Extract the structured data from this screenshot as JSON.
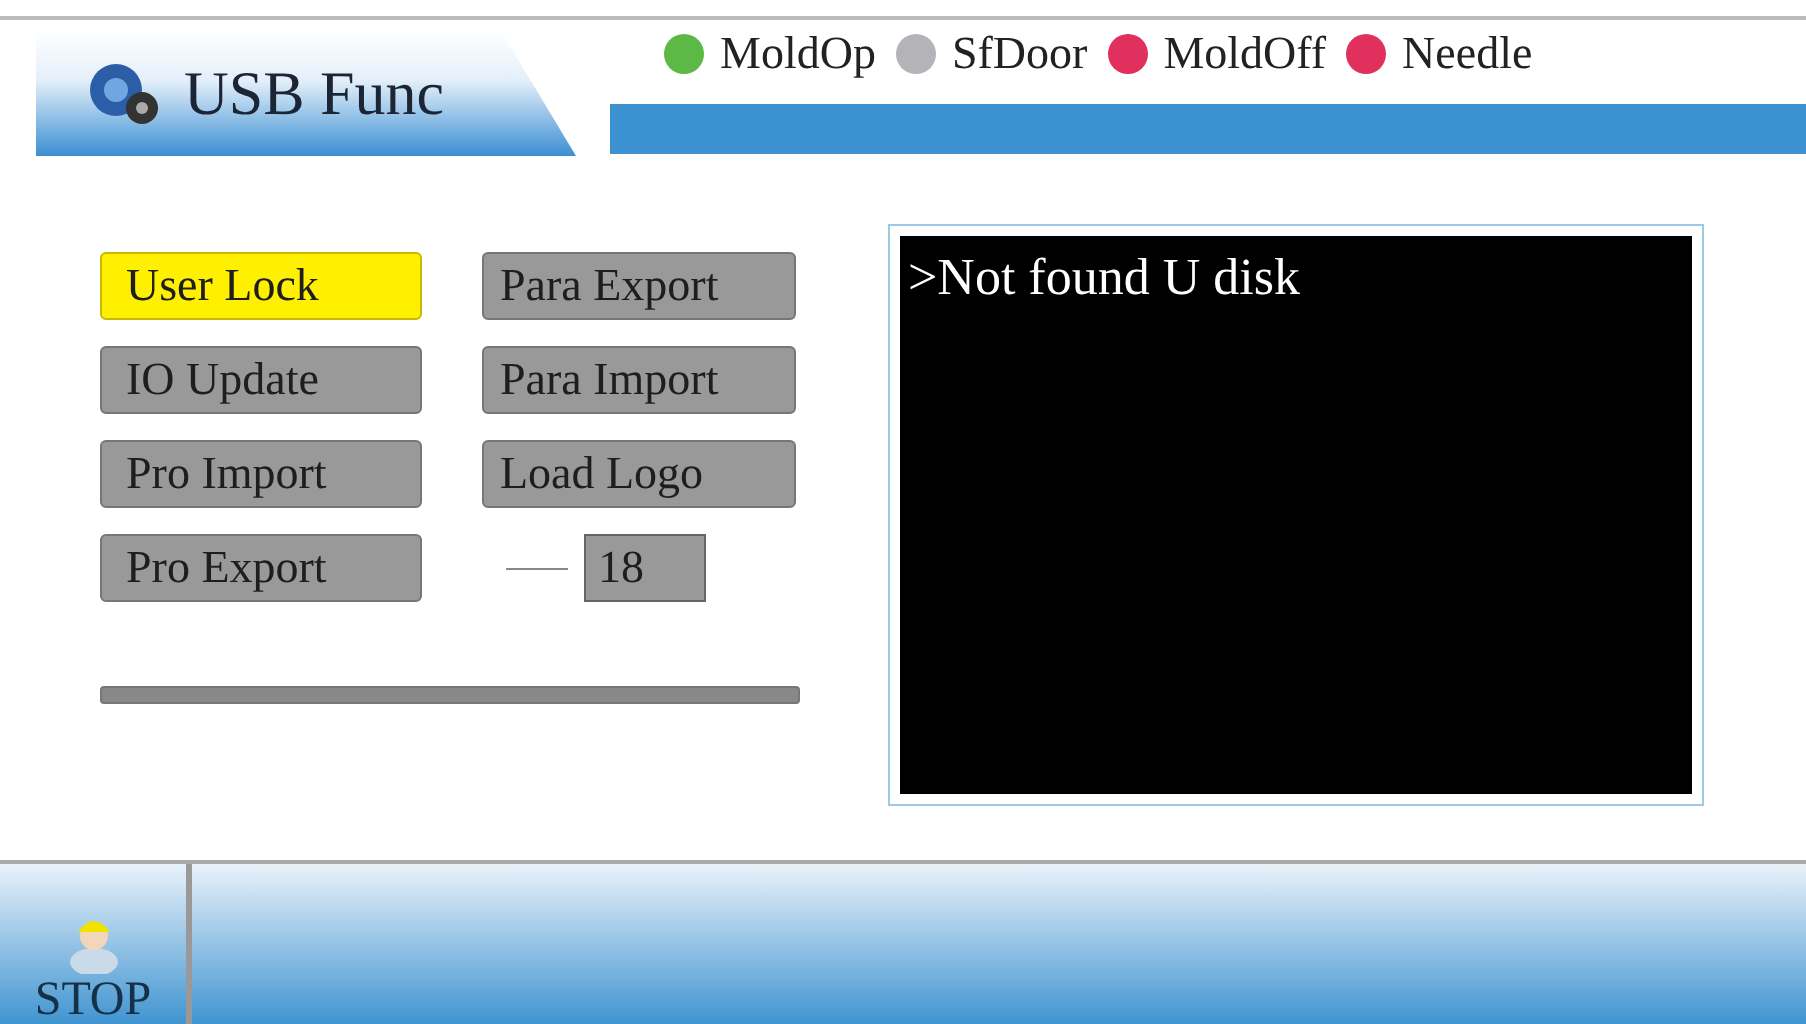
{
  "header": {
    "title": "USB Func"
  },
  "indicators": [
    {
      "label": "MoldOp",
      "color": "#5cb946"
    },
    {
      "label": "SfDoor",
      "color": "#b4b4b8"
    },
    {
      "label": "MoldOff",
      "color": "#e0305e"
    },
    {
      "label": "Needle",
      "color": "#e0305e"
    }
  ],
  "buttons_left": [
    {
      "label": "User Lock",
      "selected": true
    },
    {
      "label": "IO Update",
      "selected": false
    },
    {
      "label": "Pro Import",
      "selected": false
    },
    {
      "label": "Pro Export",
      "selected": false
    }
  ],
  "buttons_right": [
    {
      "label": "Para Export",
      "selected": false
    },
    {
      "label": "Para Import",
      "selected": false
    },
    {
      "label": "Load Logo",
      "selected": false
    }
  ],
  "number_field": {
    "value": "18"
  },
  "console": {
    "prompt": ">",
    "message": "Not found U disk"
  },
  "footer": {
    "stop_label": "STOP"
  }
}
